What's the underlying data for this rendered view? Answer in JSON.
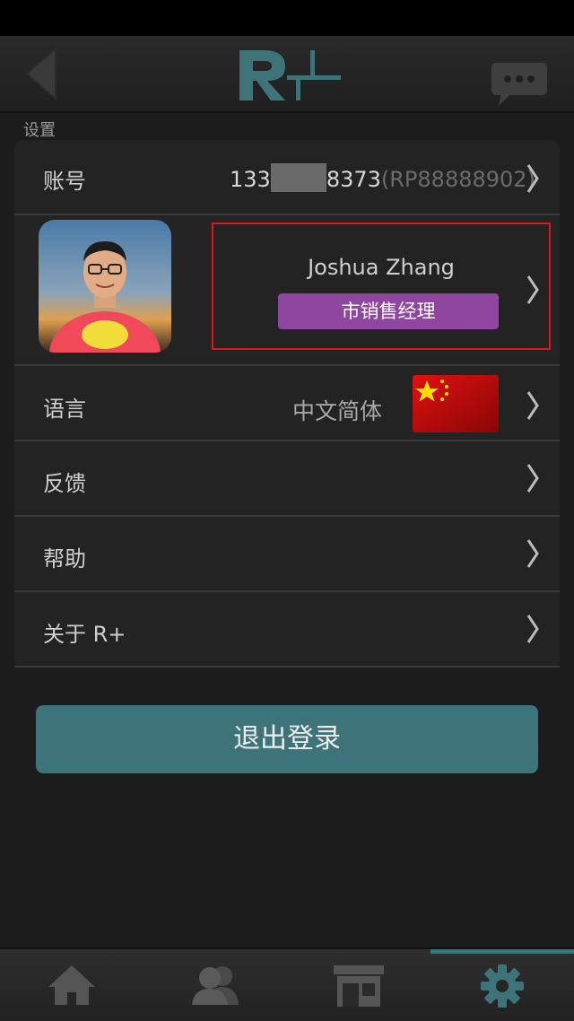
{
  "header": {
    "logo_text": "R+"
  },
  "section": {
    "label": "设置"
  },
  "account": {
    "label": "账号",
    "value_prefix": "133",
    "value_suffix": "8373",
    "code": "(RP88888902)"
  },
  "profile": {
    "name": "Joshua Zhang",
    "title": "市销售经理"
  },
  "language": {
    "label": "语言",
    "value": "中文简体",
    "flag_icon": "china-flag-icon"
  },
  "menu": {
    "feedback": "反馈",
    "help": "帮助",
    "about": "关于 R+"
  },
  "logout": {
    "label": "退出登录"
  },
  "tabs": [
    {
      "name": "home",
      "icon": "home-icon",
      "active": false
    },
    {
      "name": "contacts",
      "icon": "people-icon",
      "active": false
    },
    {
      "name": "store",
      "icon": "store-icon",
      "active": false
    },
    {
      "name": "settings",
      "icon": "gear-icon",
      "active": true
    }
  ],
  "colors": {
    "accent": "#3c7479",
    "badge": "#8e46a0",
    "highlight_border": "#e0141e"
  }
}
